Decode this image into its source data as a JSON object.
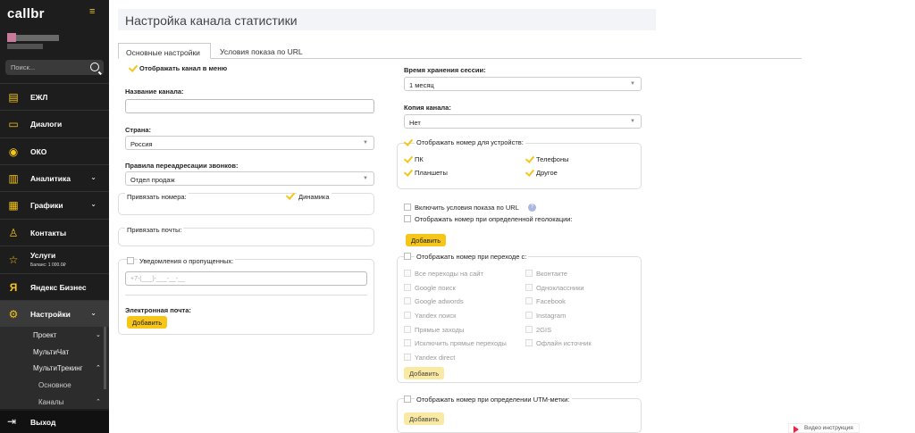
{
  "sidebar": {
    "logo": "callbr",
    "search_placeholder": "Поиск...",
    "items": [
      {
        "label": "ЕЖЛ",
        "icon": "journal-icon"
      },
      {
        "label": "Диалоги",
        "icon": "chat-icon"
      },
      {
        "label": "ОКО",
        "icon": "eye-icon"
      },
      {
        "label": "Аналитика",
        "icon": "analytics-icon"
      },
      {
        "label": "Графики",
        "icon": "chart-icon"
      },
      {
        "label": "Контакты",
        "icon": "contacts-icon"
      },
      {
        "label": "Услуги",
        "sub": "Баланс: 1 000.0₽",
        "icon": "star-icon"
      },
      {
        "label": "Яндекс Бизнес",
        "icon": "yandex-icon"
      },
      {
        "label": "Настройки",
        "icon": "gear-icon"
      }
    ],
    "submenu": [
      "Проект",
      "МультиЧат",
      "МультиТрекинг",
      "Основное",
      "Каналы"
    ],
    "logout": "Выход"
  },
  "page": {
    "title": "Настройка канала статистики",
    "tabs": [
      "Основные настройки",
      "Условия показа по URL"
    ]
  },
  "left": {
    "show_in_menu": "Отображать канал в меню",
    "channel_name_label": "Название канала:",
    "channel_name_value": "",
    "country_label": "Страна:",
    "country_value": "Россия",
    "redirect_label": "Правила переадресации звонков:",
    "redirect_value": "Отдел продаж",
    "bind_numbers": "Привязать номера:",
    "dynamic": "Динамика",
    "bind_mail": "Привязать почты:",
    "missed_notify": "Уведомления о пропущенных:",
    "phone_placeholder": "+7-(___)-___-__-__",
    "email_label": "Электронная почта:",
    "add": "Добавить"
  },
  "right": {
    "session_label": "Время хранения сессии:",
    "session_value": "1 месяц",
    "copy_label": "Копия канала:",
    "copy_value": "Нет",
    "devices_label": "Отображать номер для устройств:",
    "devices": [
      "ПК",
      "Телефоны",
      "Планшеты",
      "Другое"
    ],
    "url_conditions": "Включить условия показа по URL",
    "help": "?",
    "geo": "Отображать номер при определенной геолокации:",
    "add": "Добавить",
    "referrer_label": "Отображать номер при переходе с:",
    "referrers_left": [
      "Все переходы на сайт",
      "Google поиск",
      "Google adwords",
      "Yandex поиск",
      "Прямые заходы",
      "Исключить прямые переходы",
      "Yandex direct"
    ],
    "referrers_right": [
      "Вконтакте",
      "Одноклассники",
      "Facebook",
      "Instagram",
      "2GIS",
      "Офлайн источник"
    ],
    "utm_label": "Отображать номер при определении UTM-метки:"
  },
  "video": "Видео инструкция",
  "colors": {
    "accent": "#f5c518",
    "sidebar": "#1d1d1d"
  }
}
